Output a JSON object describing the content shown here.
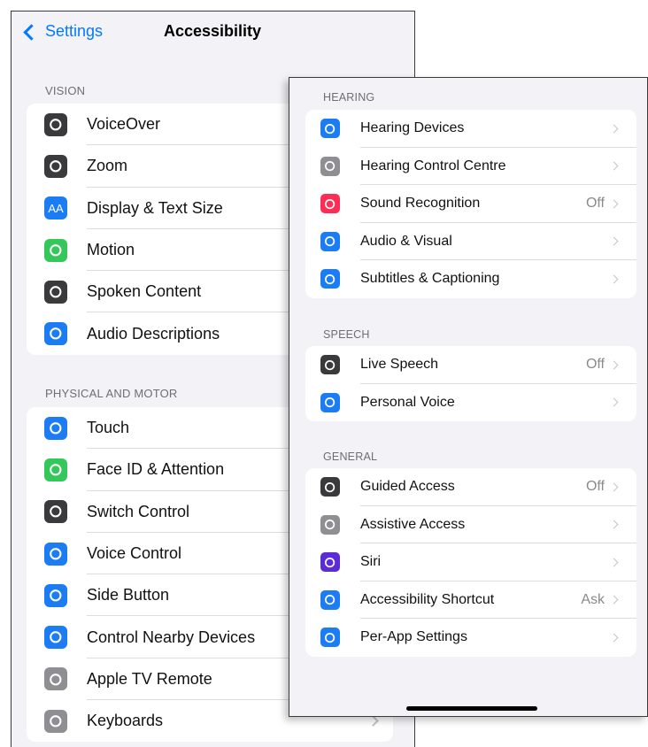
{
  "nav": {
    "back_label": "Settings",
    "title": "Accessibility"
  },
  "back_panel": {
    "vision": {
      "header": "VISION",
      "items": [
        {
          "label": "VoiceOver",
          "icon": "voiceover-icon",
          "color": "#3a3a3c"
        },
        {
          "label": "Zoom",
          "icon": "zoom-icon",
          "color": "#3a3a3c"
        },
        {
          "label": "Display & Text Size",
          "icon": "text-size-icon",
          "icon_text": "AA",
          "color": "#1c7cf4"
        },
        {
          "label": "Motion",
          "icon": "motion-icon",
          "color": "#34c759"
        },
        {
          "label": "Spoken Content",
          "icon": "spoken-content-icon",
          "color": "#3a3a3c"
        },
        {
          "label": "Audio Descriptions",
          "icon": "audio-descriptions-icon",
          "color": "#1c7cf4"
        }
      ]
    },
    "physical": {
      "header": "PHYSICAL AND MOTOR",
      "items": [
        {
          "label": "Touch",
          "icon": "touch-icon",
          "color": "#1c7cf4"
        },
        {
          "label": "Face ID & Attention",
          "icon": "face-id-icon",
          "color": "#34c759"
        },
        {
          "label": "Switch Control",
          "icon": "switch-control-icon",
          "color": "#3a3a3c"
        },
        {
          "label": "Voice Control",
          "icon": "voice-control-icon",
          "color": "#1c7cf4"
        },
        {
          "label": "Side Button",
          "icon": "side-button-icon",
          "color": "#1c7cf4"
        },
        {
          "label": "Control Nearby Devices",
          "icon": "nearby-devices-icon",
          "color": "#1c7cf4"
        },
        {
          "label": "Apple TV Remote",
          "icon": "tv-remote-icon",
          "color": "#8e8e93"
        },
        {
          "label": "Keyboards",
          "icon": "keyboard-icon",
          "color": "#8e8e93"
        }
      ]
    }
  },
  "front_panel": {
    "hearing": {
      "header": "HEARING",
      "items": [
        {
          "label": "Hearing Devices",
          "value": "",
          "icon": "ear-icon",
          "color": "#1c7cf4"
        },
        {
          "label": "Hearing Control Centre",
          "value": "",
          "icon": "toggles-icon",
          "color": "#8e8e93"
        },
        {
          "label": "Sound Recognition",
          "value": "Off",
          "icon": "sound-recognition-icon",
          "color": "#ff2d55"
        },
        {
          "label": "Audio & Visual",
          "value": "",
          "icon": "audio-visual-icon",
          "color": "#1c7cf4"
        },
        {
          "label": "Subtitles & Captioning",
          "value": "",
          "icon": "subtitles-icon",
          "color": "#1c7cf4"
        }
      ]
    },
    "speech": {
      "header": "SPEECH",
      "items": [
        {
          "label": "Live Speech",
          "value": "Off",
          "icon": "live-speech-icon",
          "color": "#3a3a3c"
        },
        {
          "label": "Personal Voice",
          "value": "",
          "icon": "personal-voice-icon",
          "color": "#1c7cf4"
        }
      ]
    },
    "general": {
      "header": "GENERAL",
      "items": [
        {
          "label": "Guided Access",
          "value": "Off",
          "icon": "lock-icon",
          "color": "#3a3a3c"
        },
        {
          "label": "Assistive Access",
          "value": "",
          "icon": "assistive-access-icon",
          "color": "#8e8e93"
        },
        {
          "label": "Siri",
          "value": "",
          "icon": "siri-icon",
          "color": "#5b2bd6"
        },
        {
          "label": "Accessibility Shortcut",
          "value": "Ask",
          "icon": "accessibility-icon",
          "color": "#1c7cf4"
        },
        {
          "label": "Per-App Settings",
          "value": "",
          "icon": "per-app-icon",
          "color": "#1c7cf4"
        }
      ]
    }
  }
}
